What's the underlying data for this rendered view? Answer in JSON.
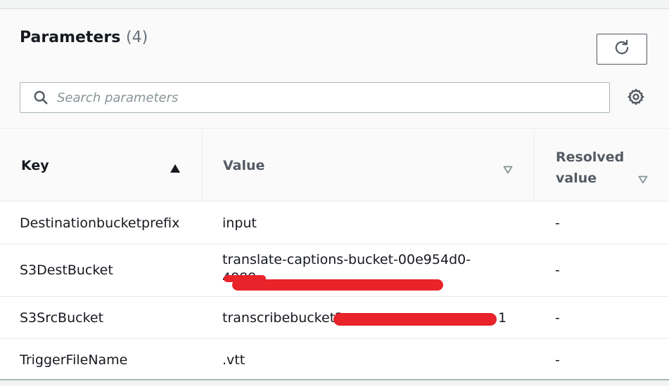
{
  "header": {
    "title": "Parameters",
    "count": "(4)"
  },
  "search": {
    "placeholder": "Search parameters",
    "value": ""
  },
  "columns": {
    "key": "Key",
    "value": "Value",
    "resolved_line1": "Resolved",
    "resolved_line2": "value"
  },
  "rows": [
    {
      "key": "Destinationbucketprefix",
      "value": "input",
      "resolved": "-"
    },
    {
      "key": "S3DestBucket",
      "value_line1": "translate-captions-bucket-00e954d0-",
      "value_line2": "4889",
      "resolved": "-"
    },
    {
      "key": "S3SrcBucket",
      "value": "transcribebucket2",
      "value_tail": "1",
      "resolved": "-"
    },
    {
      "key": "TriggerFileName",
      "value": ".vtt",
      "resolved": "-"
    }
  ],
  "icons": {
    "refresh": "refresh-icon",
    "search": "search-icon",
    "settings": "gear-icon",
    "sort_asc": "sort-ascending-icon",
    "sort_none": "sort-descending-outline-icon"
  },
  "colors": {
    "redaction": "#e8232a"
  }
}
